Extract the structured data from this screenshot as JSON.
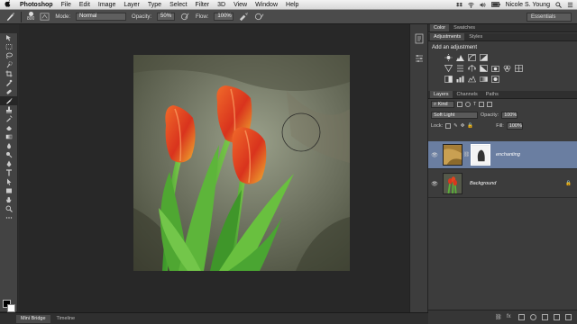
{
  "menubar": {
    "app_name": "Photoshop",
    "items": [
      "File",
      "Edit",
      "Image",
      "Layer",
      "Type",
      "Select",
      "Filter",
      "3D",
      "View",
      "Window",
      "Help"
    ],
    "user_name": "Nicole S. Young"
  },
  "options": {
    "brush_size": "800",
    "mode_label": "Mode:",
    "mode_value": "Normal",
    "opacity_label": "Opacity:",
    "opacity_value": "50%",
    "flow_label": "Flow:",
    "flow_value": "100%",
    "workspace": "Essentials"
  },
  "panels": {
    "color_tabs": [
      "Color",
      "Swatches"
    ],
    "adjust_tabs": [
      "Adjustments",
      "Styles"
    ],
    "add_adjustment": "Add an adjustment",
    "layers_tabs": [
      "Layers",
      "Channels",
      "Paths"
    ],
    "kind_label": "Kind",
    "blend_mode": "Soft Light",
    "opacity_label": "Opacity:",
    "opacity_value": "100%",
    "lock_label": "Lock:",
    "fill_label": "Fill:",
    "fill_value": "100%",
    "layers": [
      {
        "name": "enchanting",
        "selected": true
      },
      {
        "name": "Background",
        "selected": false
      }
    ]
  },
  "bottom_tabs": [
    "Mini Bridge",
    "Timeline"
  ],
  "colors": {
    "selected_layer": "#6a7ea1",
    "panel_bg": "#3c3c3c",
    "canvas_bg": "#282828"
  }
}
